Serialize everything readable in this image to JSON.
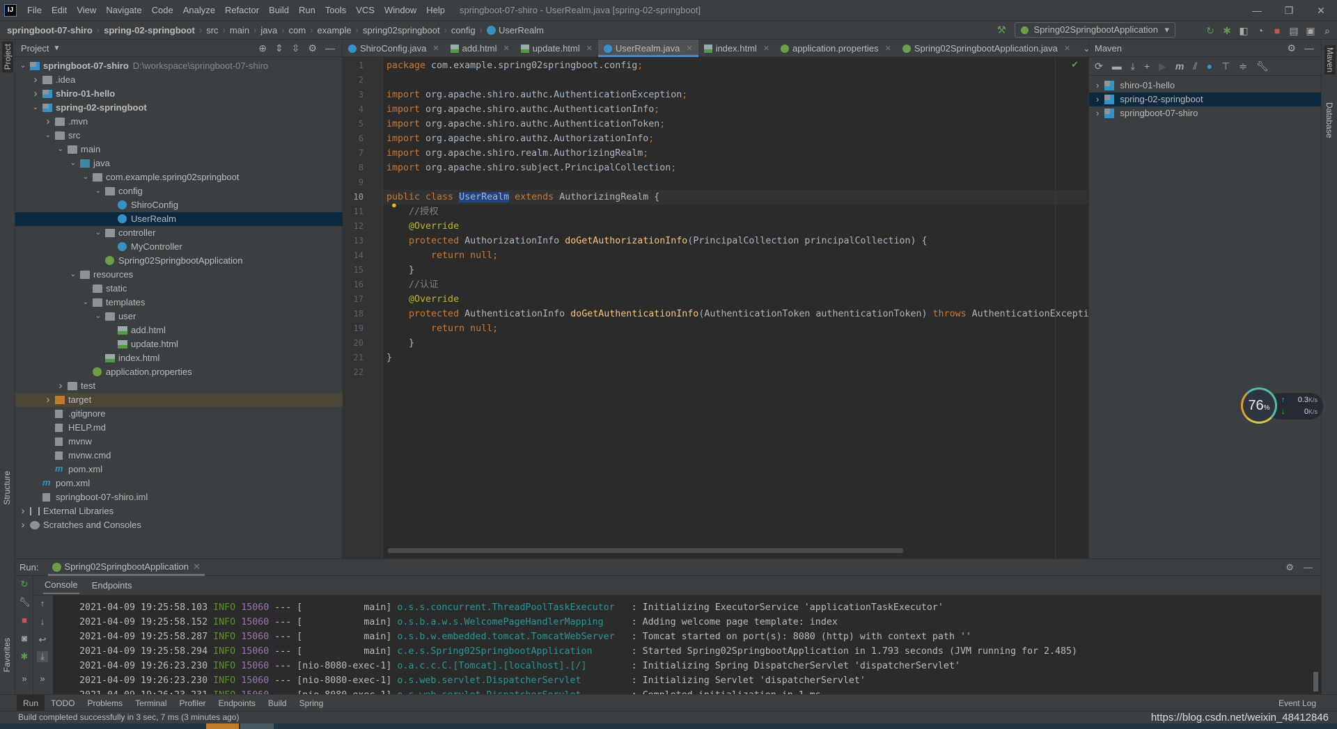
{
  "window": {
    "title": "springboot-07-shiro - UserRealm.java [spring-02-springboot]",
    "menu": [
      "File",
      "Edit",
      "View",
      "Navigate",
      "Code",
      "Analyze",
      "Refactor",
      "Build",
      "Run",
      "Tools",
      "VCS",
      "Window",
      "Help"
    ],
    "controls": [
      "minimize",
      "restore",
      "close"
    ]
  },
  "breadcrumb": [
    "springboot-07-shiro",
    "spring-02-springboot",
    "src",
    "main",
    "java",
    "com",
    "example",
    "spring02springboot",
    "config",
    "UserRealm"
  ],
  "run_config": "Spring02SpringbootApplication",
  "colors": {
    "accent": "#4a88c7",
    "keyword": "#cc7832",
    "annotation": "#bbb529",
    "method": "#ffc66d",
    "comment": "#808080",
    "selection": "#0d293e"
  },
  "left_stripe": [
    "Project",
    "Structure",
    "Favorites"
  ],
  "right_stripe": [
    "Maven",
    "Database"
  ],
  "project": {
    "header": "Project",
    "tree": [
      {
        "label": "springboot-07-shiro",
        "path": "D:\\workspace\\springboot-07-shiro",
        "level": 0,
        "arrow": "open",
        "icon": "module",
        "bold": true
      },
      {
        "label": ".idea",
        "level": 1,
        "arrow": "closed",
        "icon": "folder"
      },
      {
        "label": "shiro-01-hello",
        "level": 1,
        "arrow": "closed",
        "icon": "module",
        "bold": true
      },
      {
        "label": "spring-02-springboot",
        "level": 1,
        "arrow": "open",
        "icon": "module",
        "bold": true
      },
      {
        "label": ".mvn",
        "level": 2,
        "arrow": "closed",
        "icon": "folder"
      },
      {
        "label": "src",
        "level": 2,
        "arrow": "open",
        "icon": "folder"
      },
      {
        "label": "main",
        "level": 3,
        "arrow": "open",
        "icon": "folder"
      },
      {
        "label": "java",
        "level": 4,
        "arrow": "open",
        "icon": "folder-blue"
      },
      {
        "label": "com.example.spring02springboot",
        "level": 5,
        "arrow": "open",
        "icon": "package"
      },
      {
        "label": "config",
        "level": 6,
        "arrow": "open",
        "icon": "package"
      },
      {
        "label": "ShiroConfig",
        "level": 7,
        "icon": "class"
      },
      {
        "label": "UserRealm",
        "level": 7,
        "icon": "class",
        "selected": true
      },
      {
        "label": "controller",
        "level": 6,
        "arrow": "open",
        "icon": "package"
      },
      {
        "label": "MyController",
        "level": 7,
        "icon": "class"
      },
      {
        "label": "Spring02SpringbootApplication",
        "level": 6,
        "icon": "spring"
      },
      {
        "label": "resources",
        "level": 4,
        "arrow": "open",
        "icon": "folder"
      },
      {
        "label": "static",
        "level": 5,
        "icon": "folder"
      },
      {
        "label": "templates",
        "level": 5,
        "arrow": "open",
        "icon": "folder"
      },
      {
        "label": "user",
        "level": 6,
        "arrow": "open",
        "icon": "folder"
      },
      {
        "label": "add.html",
        "level": 7,
        "icon": "html"
      },
      {
        "label": "update.html",
        "level": 7,
        "icon": "html"
      },
      {
        "label": "index.html",
        "level": 6,
        "icon": "html"
      },
      {
        "label": "application.properties",
        "level": 5,
        "icon": "spring"
      },
      {
        "label": "test",
        "level": 3,
        "arrow": "closed",
        "icon": "folder"
      },
      {
        "label": "target",
        "level": 2,
        "arrow": "closed",
        "icon": "folder-orange",
        "highlight": true
      },
      {
        "label": ".gitignore",
        "level": 2,
        "icon": "file"
      },
      {
        "label": "HELP.md",
        "level": 2,
        "icon": "file"
      },
      {
        "label": "mvnw",
        "level": 2,
        "icon": "file"
      },
      {
        "label": "mvnw.cmd",
        "level": 2,
        "icon": "file"
      },
      {
        "label": "pom.xml",
        "level": 2,
        "icon": "maven"
      },
      {
        "label": "pom.xml",
        "level": 1,
        "icon": "maven"
      },
      {
        "label": "springboot-07-shiro.iml",
        "level": 1,
        "icon": "file"
      },
      {
        "label": "External Libraries",
        "level": 0,
        "arrow": "closed",
        "icon": "lib"
      },
      {
        "label": "Scratches and Consoles",
        "level": 0,
        "arrow": "closed",
        "icon": "scratch"
      }
    ]
  },
  "editor": {
    "tabs": [
      {
        "label": "ShiroConfig.java",
        "icon": "class"
      },
      {
        "label": "add.html",
        "icon": "html"
      },
      {
        "label": "update.html",
        "icon": "html"
      },
      {
        "label": "UserRealm.java",
        "icon": "class",
        "active": true
      },
      {
        "label": "index.html",
        "icon": "html"
      },
      {
        "label": "application.properties",
        "icon": "spring"
      },
      {
        "label": "Spring02SpringbootApplication.java",
        "icon": "spring"
      }
    ],
    "current_line": 10,
    "lines": [
      [
        [
          "k",
          "package "
        ],
        [
          "t",
          "com.example.spring02springboot.config"
        ],
        [
          "k",
          ";"
        ]
      ],
      [],
      [
        [
          "k",
          "import "
        ],
        [
          "t",
          "org.apache.shiro.authc.AuthenticationException"
        ],
        [
          "k",
          ";"
        ]
      ],
      [
        [
          "k",
          "import "
        ],
        [
          "t",
          "org.apache.shiro.authc.AuthenticationInfo"
        ],
        [
          "k",
          ";"
        ]
      ],
      [
        [
          "k",
          "import "
        ],
        [
          "t",
          "org.apache.shiro.authc.AuthenticationToken"
        ],
        [
          "k",
          ";"
        ]
      ],
      [
        [
          "k",
          "import "
        ],
        [
          "t",
          "org.apache.shiro.authz.AuthorizationInfo"
        ],
        [
          "k",
          ";"
        ]
      ],
      [
        [
          "k",
          "import "
        ],
        [
          "t",
          "org.apache.shiro.realm.AuthorizingRealm"
        ],
        [
          "k",
          ";"
        ]
      ],
      [
        [
          "k",
          "import "
        ],
        [
          "t",
          "org.apache.shiro.subject.PrincipalCollection"
        ],
        [
          "k",
          ";"
        ]
      ],
      [],
      [
        [
          "k",
          "public class "
        ],
        [
          "s",
          "UserRealm"
        ],
        [
          "k",
          " extends "
        ],
        [
          "t",
          "AuthorizingRealm {"
        ]
      ],
      [
        [
          "c",
          "    //授权"
        ]
      ],
      [
        [
          "a",
          "    @Override"
        ]
      ],
      [
        [
          "k",
          "    protected "
        ],
        [
          "t",
          "AuthorizationInfo "
        ],
        [
          "m",
          "doGetAuthorizationInfo"
        ],
        [
          "t",
          "(PrincipalCollection principalCollection) {"
        ]
      ],
      [
        [
          "k",
          "        return null;"
        ]
      ],
      [
        [
          "t",
          "    }"
        ]
      ],
      [
        [
          "c",
          "    //认证"
        ]
      ],
      [
        [
          "a",
          "    @Override"
        ]
      ],
      [
        [
          "k",
          "    protected "
        ],
        [
          "t",
          "AuthenticationInfo "
        ],
        [
          "m",
          "doGetAuthenticationInfo"
        ],
        [
          "t",
          "(AuthenticationToken authenticationToken) "
        ],
        [
          "k",
          "throws "
        ],
        [
          "t",
          "AuthenticationException {"
        ]
      ],
      [
        [
          "k",
          "        return null;"
        ]
      ],
      [
        [
          "t",
          "    }"
        ]
      ],
      [
        [
          "t",
          "}"
        ]
      ],
      []
    ]
  },
  "maven": {
    "header": "Maven",
    "projects": [
      {
        "label": "shiro-01-hello"
      },
      {
        "label": "spring-02-springboot",
        "selected": true
      },
      {
        "label": "springboot-07-shiro"
      }
    ]
  },
  "monitor": {
    "cpu": "76",
    "cpu_unit": "%",
    "up": "0.3",
    "down": "0",
    "unit": "K/s"
  },
  "run": {
    "label": "Run:",
    "tab": "Spring02SpringbootApplication",
    "console_tabs": [
      "Console",
      "Endpoints"
    ],
    "log": [
      {
        "date": "2021-04-09 19:25:58.103",
        "level": "INFO",
        "pid": "15060",
        "thread": "           main",
        "logger": "o.s.s.concurrent.ThreadPoolTaskExecutor  ",
        "msg": "Initializing ExecutorService 'applicationTaskExecutor'"
      },
      {
        "date": "2021-04-09 19:25:58.152",
        "level": "INFO",
        "pid": "15060",
        "thread": "           main",
        "logger": "o.s.b.a.w.s.WelcomePageHandlerMapping    ",
        "msg": "Adding welcome page template: index"
      },
      {
        "date": "2021-04-09 19:25:58.287",
        "level": "INFO",
        "pid": "15060",
        "thread": "           main",
        "logger": "o.s.b.w.embedded.tomcat.TomcatWebServer  ",
        "msg": "Tomcat started on port(s): 8080 (http) with context path ''"
      },
      {
        "date": "2021-04-09 19:25:58.294",
        "level": "INFO",
        "pid": "15060",
        "thread": "           main",
        "logger": "c.e.s.Spring02SpringbootApplication      ",
        "msg": "Started Spring02SpringbootApplication in 1.793 seconds (JVM running for 2.485)"
      },
      {
        "date": "2021-04-09 19:26:23.230",
        "level": "INFO",
        "pid": "15060",
        "thread": "nio-8080-exec-1",
        "logger": "o.a.c.c.C.[Tomcat].[localhost].[/]       ",
        "msg": "Initializing Spring DispatcherServlet 'dispatcherServlet'"
      },
      {
        "date": "2021-04-09 19:26:23.230",
        "level": "INFO",
        "pid": "15060",
        "thread": "nio-8080-exec-1",
        "logger": "o.s.web.servlet.DispatcherServlet        ",
        "msg": "Initializing Servlet 'dispatcherServlet'"
      },
      {
        "date": "2021-04-09 19:26:23.231",
        "level": "INFO",
        "pid": "15060",
        "thread": "nio-8080-exec-1",
        "logger": "o.s.web.servlet.DispatcherServlet        ",
        "msg": "Completed initialization in 1 ms"
      }
    ]
  },
  "bottom_tools": [
    "Run",
    "TODO",
    "Problems",
    "Terminal",
    "Profiler",
    "Endpoints",
    "Build",
    "Spring"
  ],
  "event_log": "Event Log",
  "status": "Build completed successfully in 3 sec, 7 ms (3 minutes ago)",
  "watermark": "https://blog.csdn.net/weixin_48412846"
}
